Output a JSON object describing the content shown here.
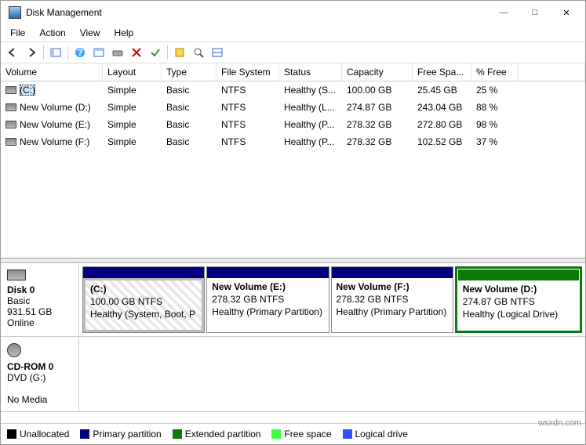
{
  "window": {
    "title": "Disk Management"
  },
  "menu": {
    "file": "File",
    "action": "Action",
    "view": "View",
    "help": "Help"
  },
  "columns": {
    "volume": "Volume",
    "layout": "Layout",
    "type": "Type",
    "filesystem": "File System",
    "status": "Status",
    "capacity": "Capacity",
    "freespace": "Free Spa...",
    "pctfree": "% Free"
  },
  "volumes": [
    {
      "name": "(C:)",
      "layout": "Simple",
      "type": "Basic",
      "fs": "NTFS",
      "status": "Healthy (S...",
      "capacity": "100.00 GB",
      "free": "25.45 GB",
      "pct": "25 %",
      "selected": true
    },
    {
      "name": "New Volume (D:)",
      "layout": "Simple",
      "type": "Basic",
      "fs": "NTFS",
      "status": "Healthy (L...",
      "capacity": "274.87 GB",
      "free": "243.04 GB",
      "pct": "88 %",
      "selected": false
    },
    {
      "name": "New Volume (E:)",
      "layout": "Simple",
      "type": "Basic",
      "fs": "NTFS",
      "status": "Healthy (P...",
      "capacity": "278.32 GB",
      "free": "272.80 GB",
      "pct": "98 %",
      "selected": false
    },
    {
      "name": "New Volume (F:)",
      "layout": "Simple",
      "type": "Basic",
      "fs": "NTFS",
      "status": "Healthy (P...",
      "capacity": "278.32 GB",
      "free": "102.52 GB",
      "pct": "37 %",
      "selected": false
    }
  ],
  "disk0": {
    "label": "Disk 0",
    "type": "Basic",
    "size": "931.51 GB",
    "state": "Online",
    "parts": [
      {
        "title": "(C:)",
        "line2": "100.00 GB NTFS",
        "line3": "Healthy (System, Boot, P",
        "style": "hatched primary"
      },
      {
        "title": "New Volume  (E:)",
        "line2": "278.32 GB NTFS",
        "line3": "Healthy (Primary Partition)",
        "style": "primary"
      },
      {
        "title": "New Volume  (F:)",
        "line2": "278.32 GB NTFS",
        "line3": "Healthy (Primary Partition)",
        "style": "primary"
      },
      {
        "title": "New Volume  (D:)",
        "line2": "274.87 GB NTFS",
        "line3": "Healthy (Logical Drive)",
        "style": "extended"
      }
    ]
  },
  "cdrom": {
    "label": "CD-ROM 0",
    "line2": "DVD (G:)",
    "line3": "No Media"
  },
  "legend": {
    "unallocated": "Unallocated",
    "primary": "Primary partition",
    "extended": "Extended partition",
    "freespace": "Free space",
    "logical": "Logical drive"
  },
  "watermark": "wsxdn.com"
}
